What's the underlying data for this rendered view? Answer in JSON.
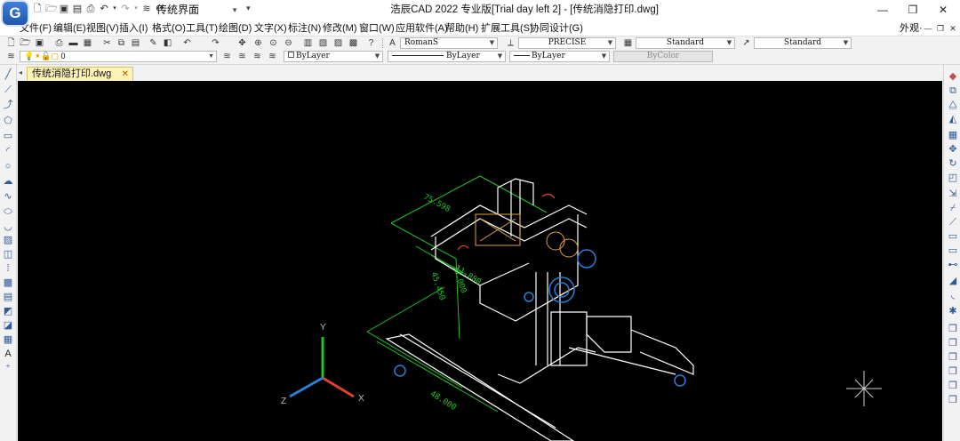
{
  "titlebar": {
    "logo_letter": "G",
    "workspace": "传统界面",
    "window_title": "浩辰CAD 2022 专业版[Trial day left 2] - [传统消隐打印.dwg]"
  },
  "menubar": {
    "items": [
      "文件(F)",
      "编辑(E)",
      "视图(V)",
      "插入(I)",
      "格式(O)",
      "工具(T)",
      "绘图(D)",
      "文字(X)",
      "标注(N)",
      "修改(M)",
      "窗口(W)",
      "应用软件(A)",
      "帮助(H)",
      "扩展工具(S)",
      "协同设计(G)"
    ],
    "appearance": "外观·"
  },
  "toolbar1": {
    "text_style": "RomanS",
    "dim_style": "PRECISE",
    "table_style": "Standard",
    "multileader_style": "Standard"
  },
  "toolbar2": {
    "layer": "0",
    "color": "ByLayer",
    "linetype": "ByLayer",
    "lineweight": "ByLayer",
    "plot_style": "ByColor"
  },
  "document": {
    "tab_label": "传统消隐打印.dwg"
  },
  "canvas": {
    "background": "#000000",
    "ucs_labels": {
      "x": "X",
      "y": "Y",
      "z": "Z"
    },
    "dimensions": [
      "75.598",
      "30.000",
      "45.450",
      "11.880",
      "48.000"
    ]
  },
  "colors": {
    "model_lines": "#ffffff",
    "dimensions": "#22c322",
    "accent_orange": "#e0a040",
    "accent_blue": "#2a7fd6",
    "accent_red": "#e0402c"
  },
  "icons": {
    "qa": [
      "new-icon",
      "open-icon",
      "save-icon",
      "save-as-icon",
      "print-icon",
      "undo-icon",
      "redo-icon",
      "layers-icon",
      "sync-icon"
    ],
    "left": [
      "line-icon",
      "construction-line-icon",
      "polyline-icon",
      "polygon-icon",
      "rectangle-icon",
      "arc-icon",
      "circle-icon",
      "revcloud-icon",
      "spline-icon",
      "ellipse-icon",
      "ellipse-arc-icon",
      "insert-block-icon",
      "make-block-icon",
      "point-icon",
      "hatch-icon",
      "gradient-icon",
      "region-icon",
      "wipeout-icon",
      "table-icon",
      "mtext-icon",
      "add-selected-icon"
    ],
    "right": [
      "erase-icon",
      "copy-icon",
      "mirror-icon",
      "offset-icon",
      "array-icon",
      "move-icon",
      "rotate-icon",
      "scale-icon",
      "stretch-icon",
      "trim-icon",
      "extend-icon",
      "break-point-icon",
      "break-icon",
      "join-icon",
      "chamfer-icon",
      "fillet-icon",
      "explode-icon",
      "draworder-icon"
    ]
  }
}
